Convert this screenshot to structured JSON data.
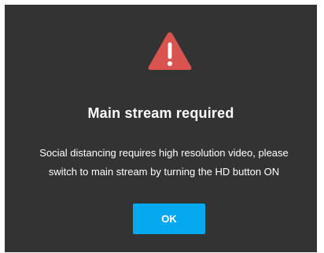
{
  "dialog": {
    "icon": "warning-triangle-icon",
    "icon_color": "#d9534f",
    "title": "Main stream required",
    "message_line1": "Social distancing requires high resolution video, please",
    "message_line2": "switch to main stream by turning the HD button ON",
    "ok_label": "OK",
    "background_color": "#333333",
    "button_color": "#06a8f0"
  }
}
